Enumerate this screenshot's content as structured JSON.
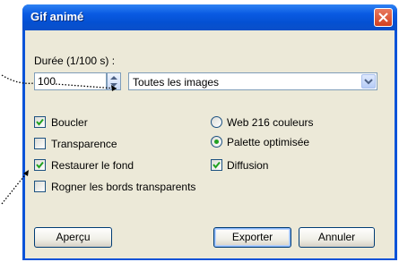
{
  "window": {
    "title": "Gif animé"
  },
  "icons": {
    "close": "close-icon",
    "spin": "spin-up-down-icon",
    "dropdown": "chevron-down-icon",
    "check": "check-icon"
  },
  "duration": {
    "label": "Durée (1/100 s) :",
    "value": "100"
  },
  "frames_select": {
    "selected": "Toutes les images"
  },
  "options": {
    "loop": {
      "label": "Boucler",
      "checked": true
    },
    "transparency": {
      "label": "Transparence",
      "checked": false
    },
    "restore_bg": {
      "label": "Restaurer le fond",
      "checked": true
    },
    "crop": {
      "label": "Rogner les bords transparents",
      "checked": false
    }
  },
  "palette": {
    "web216": {
      "label": "Web 216 couleurs",
      "selected": false
    },
    "optimized": {
      "label": "Palette optimisée",
      "selected": true
    }
  },
  "diffusion": {
    "label": "Diffusion",
    "checked": true
  },
  "buttons": {
    "preview": "Aperçu",
    "export": "Exporter",
    "cancel": "Annuler"
  },
  "colors": {
    "title_bar": "#0a5be3",
    "client_bg": "#ece9d8",
    "check": "#21a121"
  }
}
